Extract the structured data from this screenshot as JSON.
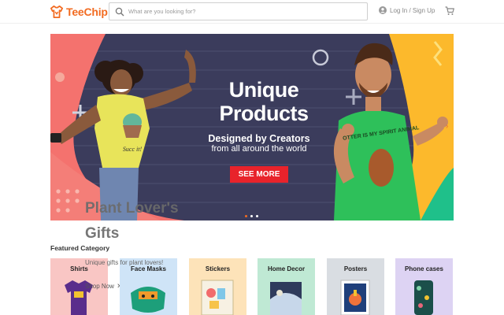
{
  "header": {
    "logo_text": "TeeChip",
    "search_placeholder": "What are you looking for?",
    "login_label": "Log In / Sign Up",
    "icons": [
      "teechip-logo-icon",
      "search-icon",
      "user-icon",
      "cart-icon"
    ]
  },
  "banner": {
    "title_line1": "Unique",
    "title_line2": "Products",
    "subtitle_line1": "Designed by Creators",
    "subtitle_line2": "from all around the world",
    "button_label": "SEE MORE",
    "shirt_text_left": "Succ it!",
    "shirt_text_right": "OTTER IS MY SPIRIT ANIMAL",
    "slide_count": 3,
    "active_slide": 1
  },
  "overlay": {
    "title": "Plant Lover's Gifts",
    "subtitle": "Unique gifts for plant lovers!",
    "link_label": "Shop Now"
  },
  "featured": {
    "heading": "Featured Category",
    "categories": [
      {
        "label": "Shirts",
        "color": "#f9c6c4"
      },
      {
        "label": "Face Masks",
        "color": "#cfe4f7"
      },
      {
        "label": "Stickers",
        "color": "#fde3b9"
      },
      {
        "label": "Home Decor",
        "color": "#bfe9d4"
      },
      {
        "label": "Posters",
        "color": "#d9dde2"
      },
      {
        "label": "Phone cases",
        "color": "#ddd3f3"
      }
    ]
  },
  "colors": {
    "brand": "#f26b21",
    "cta": "#e8232b"
  }
}
